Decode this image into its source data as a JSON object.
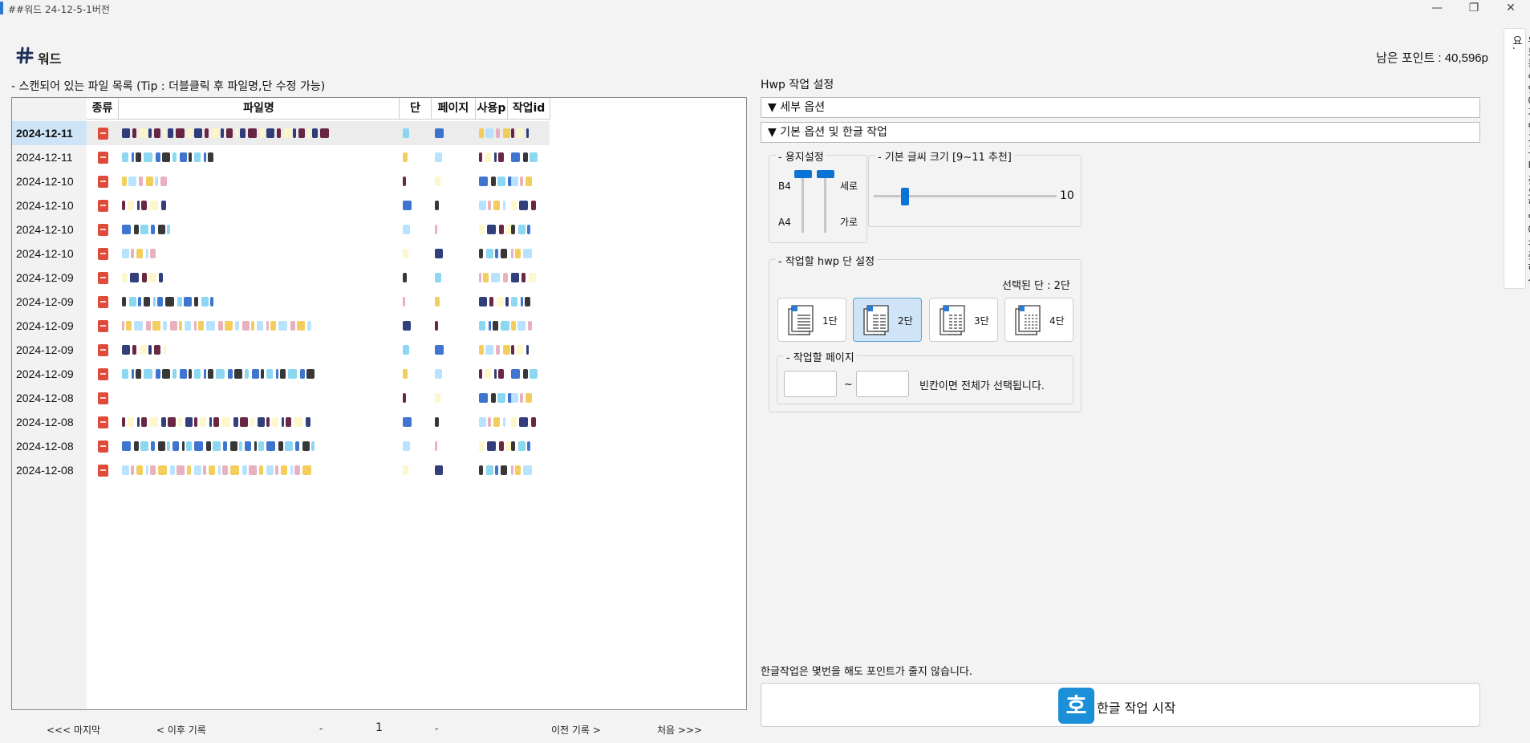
{
  "window": {
    "title": "##워드 24-12-5-1버전",
    "minimize": "—",
    "maximize": "❐",
    "close": "✕"
  },
  "header": {
    "app_name": "워드",
    "points_label": "남은 포인트 : 40,596p"
  },
  "side_banner": {
    "text": "워드는 업양에게 맡기고 더 중요한 일에 집중하세요."
  },
  "file_list": {
    "label": "- 스캔되어 있는 파일 목록 (Tip : 더블클릭 후 파일명,단 수정 가능)",
    "columns": [
      "종류",
      "파일명",
      "단",
      "페이지",
      "사용p",
      "작업id"
    ],
    "rows": [
      {
        "date": "2024-12-11",
        "selected": true
      },
      {
        "date": "2024-12-11"
      },
      {
        "date": "2024-12-10"
      },
      {
        "date": "2024-12-10"
      },
      {
        "date": "2024-12-10"
      },
      {
        "date": "2024-12-10"
      },
      {
        "date": "2024-12-09"
      },
      {
        "date": "2024-12-09"
      },
      {
        "date": "2024-12-09"
      },
      {
        "date": "2024-12-09"
      },
      {
        "date": "2024-12-09"
      },
      {
        "date": "2024-12-08"
      },
      {
        "date": "2024-12-08"
      },
      {
        "date": "2024-12-08"
      },
      {
        "date": "2024-12-08"
      }
    ]
  },
  "pager": {
    "last": "<<< 마지막",
    "next": "< 이후 기록",
    "dash_left": "-",
    "page": "1",
    "dash_right": "-",
    "prev": "이전 기록 >",
    "first": "처음 >>>"
  },
  "hwp": {
    "title": "Hwp 작업 설정",
    "detail_options": "▼ 세부 옵션",
    "basic_options": "▼ 기본 옵션 및 한글 작업",
    "paper": {
      "legend": "- 용지설정",
      "b4": "B4",
      "a4": "A4",
      "vertical": "세로",
      "horizontal": "가로"
    },
    "font": {
      "legend": "- 기본 글씨 크기 [9~11 추천]",
      "value": "10"
    },
    "columns": {
      "legend": "- 작업할 hwp 단 설정",
      "selected_text": "선택된 단 : 2단",
      "options": [
        "1단",
        "2단",
        "3단",
        "4단"
      ],
      "selected_index": 1
    },
    "pages": {
      "legend": "- 작업할 페이지",
      "tilde": "~",
      "hint": "빈칸이면 전체가 선택됩니다.",
      "from_value": "",
      "to_value": ""
    },
    "notice": "한글작업은 몇번을 해도 포인트가 줄지 않습니다.",
    "start_button": "한글 작업 시작",
    "start_icon": "호"
  }
}
